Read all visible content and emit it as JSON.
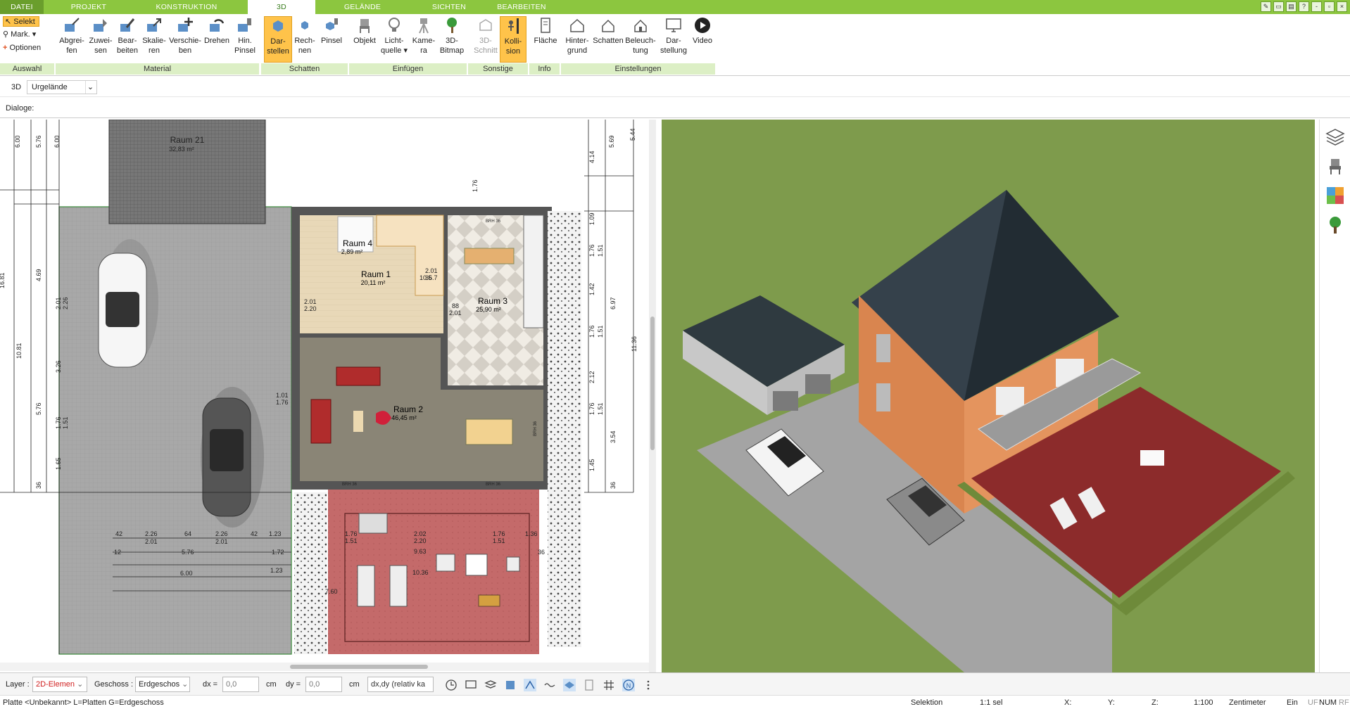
{
  "tabs": {
    "file": "DATEI",
    "project": "PROJEKT",
    "construction": "KONSTRUKTION",
    "threed": "3D",
    "terrain": "GELÄNDE",
    "views": "SICHTEN",
    "edit": "BEARBEITEN"
  },
  "window": {
    "minimize": "-",
    "restore": "▫",
    "close": "×",
    "help": "?"
  },
  "ribbon": {
    "auswahl": {
      "select": "Selekt",
      "mark": "Mark.",
      "options": "Optionen",
      "group": "Auswahl"
    },
    "material": {
      "b1": [
        "Abgrei-",
        "fen"
      ],
      "b2": [
        "Zuwei-",
        "sen"
      ],
      "b3": [
        "Bear-",
        "beiten"
      ],
      "b4": [
        "Skalie-",
        "ren"
      ],
      "b5": [
        "Verschie-",
        "ben"
      ],
      "b6": [
        "Drehen",
        ""
      ],
      "b7": [
        "Hin.",
        "Pinsel"
      ],
      "group": "Material"
    },
    "schatten": {
      "b1": [
        "Dar-",
        "stellen"
      ],
      "b2": [
        "Rech-",
        "nen"
      ],
      "b3": [
        "Pinsel",
        ""
      ],
      "group": "Schatten"
    },
    "einfuegen": {
      "b1": [
        "Objekt",
        ""
      ],
      "b2": [
        "Licht-",
        "quelle"
      ],
      "b3": [
        "Kame-",
        "ra"
      ],
      "b4": [
        "3D-",
        "Bitmap"
      ],
      "group": "Einfügen"
    },
    "sonstige": {
      "b1": [
        "3D-",
        "Schnitt"
      ],
      "b2": [
        "Kolli-",
        "sion"
      ],
      "group": "Sonstige"
    },
    "info": {
      "b1": [
        "Fläche",
        ""
      ],
      "group": "Info"
    },
    "einstellungen": {
      "b1": [
        "Hinter-",
        "grund"
      ],
      "b2": [
        "Schatten",
        ""
      ],
      "b3": [
        "Beleuch-",
        "tung"
      ],
      "b4": [
        "Dar-",
        "stellung"
      ],
      "b5": [
        "Video",
        ""
      ],
      "group": "Einstellungen"
    }
  },
  "row3d": {
    "label": "3D",
    "dropdown": "Urgelände"
  },
  "dialog": {
    "label": "Dialoge:"
  },
  "plan": {
    "rooms": [
      {
        "name": "Raum 21",
        "area": "32,83 m²"
      },
      {
        "name": "Raum 4",
        "area": "2,89 m²"
      },
      {
        "name": "Raum 1",
        "area": "20,11 m²"
      },
      {
        "name": "Raum 3",
        "area": "25,90 m²"
      },
      {
        "name": "Raum 2",
        "area": "46,45 m²"
      }
    ],
    "dims_bottom": [
      "42",
      "2.26",
      "64",
      "2.26",
      "42",
      "1.23",
      "2.01",
      "2.01",
      "5.76",
      "1.72",
      "6.00",
      "1.23",
      "1.76",
      "1.51",
      "2.02",
      "2.20",
      "1.76",
      "1.51",
      "9.63",
      "10.36",
      "7.60",
      "1.36",
      "36",
      "12"
    ],
    "dims_left": [
      "6.00",
      "5.76",
      "6.00",
      "4.69",
      "2.01",
      "2.26",
      "10.81",
      "16.81",
      "3.26",
      "5.76",
      "1.51",
      "1.76",
      "1.65",
      "36"
    ],
    "dims_right": [
      "4.14",
      "5.69",
      "5.44",
      "1.09",
      "1.76",
      "1.51",
      "1.42",
      "6.97",
      "1.76",
      "1.51",
      "11.36",
      "2.12",
      "1.76",
      "1.51",
      "3.54",
      "1.45",
      "36"
    ],
    "small": [
      "1.76",
      "1.01",
      "2.01",
      "2.20",
      "88",
      "2.01",
      "1.76",
      "1.51",
      "88",
      "2.01",
      "10.5",
      "36.7",
      "BRH 36",
      "BRH 36",
      "BRH 36",
      "BRH 36"
    ]
  },
  "bottombar": {
    "layer_label": "Layer :",
    "layer_value": "2D-Elemen",
    "floor_label": "Geschoss :",
    "floor_value": "Erdgeschos",
    "dx_label": "dx =",
    "dx_value": "0,0",
    "dx_unit": "cm",
    "dy_label": "dy =",
    "dy_value": "0,0",
    "dy_unit": "cm",
    "mode_value": "dx,dy (relativ ka"
  },
  "status": {
    "left": "Platte <Unbekannt> L=Platten G=Erdgeschoss",
    "mode": "Selektion",
    "selcount": "1:1 sel",
    "x": "X:",
    "y": "Y:",
    "z": "Z:",
    "scale": "1:100",
    "unit": "Zentimeter",
    "ein": "Ein",
    "uf": "UF",
    "num": "NUM",
    "rf": "RF"
  },
  "colors": {
    "accent": "#8cc63f",
    "group_bg": "#dcefc5",
    "selected": "#ffc34a",
    "grass": "#7a9a4a",
    "roof": "#2e3a44",
    "wall": "#d88a58",
    "terrace": "#9a3030",
    "driveway": "#9a9a9a"
  }
}
